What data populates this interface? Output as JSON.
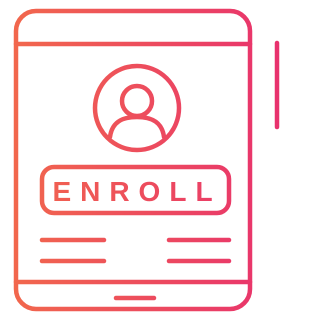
{
  "enroll_button": {
    "label": "ENROLL"
  },
  "icons": {
    "device": "tablet-icon",
    "user": "user-avatar-icon"
  },
  "colors": {
    "gradient_start": "#F26A4B",
    "gradient_end": "#E8316E",
    "background": "#FFFFFF"
  }
}
